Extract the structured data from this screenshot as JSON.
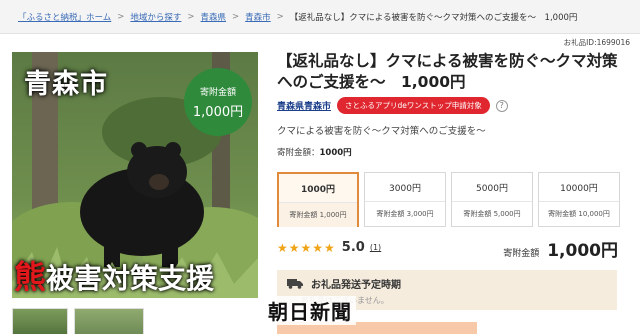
{
  "breadcrumb": {
    "items": [
      "「ふるさと納税」ホーム",
      "地域から探す",
      "青森県",
      "青森市"
    ],
    "current": "【返礼品なし】クマによる被害を防ぐ～クマ対策へのご支援を～　1,000円",
    "separator": ">"
  },
  "item_id": "お礼品ID:1699016",
  "hero": {
    "city_text": "青森市",
    "badge_label": "寄附金額",
    "badge_amount": "1,000円",
    "caption_first": "熊",
    "caption_rest": "被害対策支援",
    "colors": {
      "badge": "#2f8a3c",
      "caption_accent": "#e0181c"
    }
  },
  "product": {
    "title": "【返礼品なし】クマによる被害を防ぐ～クマ対策へのご支援を～　1,000円",
    "municipality": "青森県青森市",
    "app_badge": "さとふるアプリdeワンストップ申請対象",
    "help_icon": "?",
    "description": "クマによる被害を防ぐ～クマ対策へのご支援を～",
    "amount_label": "寄附金額：",
    "amount_value": "1000円"
  },
  "options": [
    {
      "price": "1000円",
      "detail": "寄附金額 1,000円",
      "selected": true
    },
    {
      "price": "3000円",
      "detail": "寄附金額 3,000円",
      "selected": false
    },
    {
      "price": "5000円",
      "detail": "寄附金額 5,000円",
      "selected": false
    },
    {
      "price": "10000円",
      "detail": "寄附金額 10,000円",
      "selected": false
    }
  ],
  "rating": {
    "stars": "★★★★★",
    "value": "5.0",
    "count": "(1)"
  },
  "price": {
    "label": "寄附金額",
    "value": "1,000円"
  },
  "shipping": {
    "title": "お礼品発送予定時期",
    "body": "お礼品はございません。",
    "icon": "truck-icon"
  },
  "watermark": "朝日新聞",
  "colors": {
    "accent": "#e08a3c",
    "badge_red": "#e0262e",
    "link": "#1b3f8a",
    "star": "#f0a418"
  }
}
